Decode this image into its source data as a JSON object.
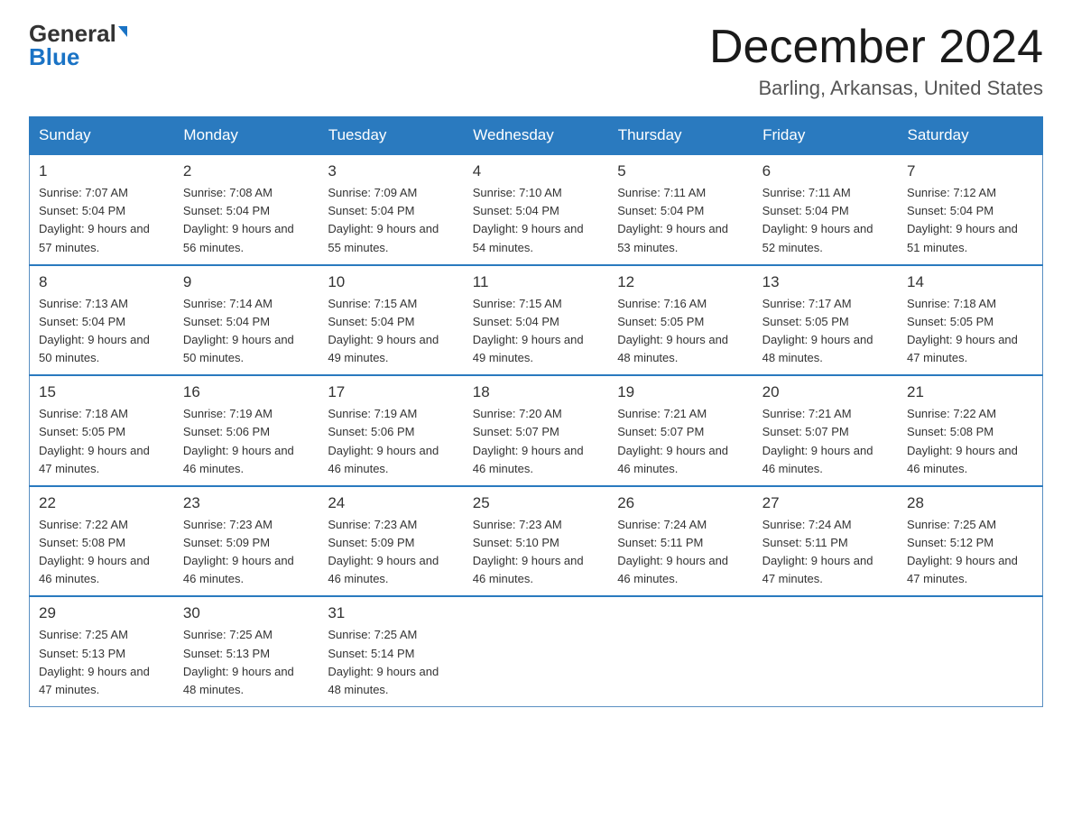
{
  "header": {
    "logo_general": "General",
    "logo_blue": "Blue",
    "month_title": "December 2024",
    "location": "Barling, Arkansas, United States"
  },
  "weekdays": [
    "Sunday",
    "Monday",
    "Tuesday",
    "Wednesday",
    "Thursday",
    "Friday",
    "Saturday"
  ],
  "weeks": [
    [
      {
        "day": "1",
        "sunrise": "Sunrise: 7:07 AM",
        "sunset": "Sunset: 5:04 PM",
        "daylight": "Daylight: 9 hours and 57 minutes."
      },
      {
        "day": "2",
        "sunrise": "Sunrise: 7:08 AM",
        "sunset": "Sunset: 5:04 PM",
        "daylight": "Daylight: 9 hours and 56 minutes."
      },
      {
        "day": "3",
        "sunrise": "Sunrise: 7:09 AM",
        "sunset": "Sunset: 5:04 PM",
        "daylight": "Daylight: 9 hours and 55 minutes."
      },
      {
        "day": "4",
        "sunrise": "Sunrise: 7:10 AM",
        "sunset": "Sunset: 5:04 PM",
        "daylight": "Daylight: 9 hours and 54 minutes."
      },
      {
        "day": "5",
        "sunrise": "Sunrise: 7:11 AM",
        "sunset": "Sunset: 5:04 PM",
        "daylight": "Daylight: 9 hours and 53 minutes."
      },
      {
        "day": "6",
        "sunrise": "Sunrise: 7:11 AM",
        "sunset": "Sunset: 5:04 PM",
        "daylight": "Daylight: 9 hours and 52 minutes."
      },
      {
        "day": "7",
        "sunrise": "Sunrise: 7:12 AM",
        "sunset": "Sunset: 5:04 PM",
        "daylight": "Daylight: 9 hours and 51 minutes."
      }
    ],
    [
      {
        "day": "8",
        "sunrise": "Sunrise: 7:13 AM",
        "sunset": "Sunset: 5:04 PM",
        "daylight": "Daylight: 9 hours and 50 minutes."
      },
      {
        "day": "9",
        "sunrise": "Sunrise: 7:14 AM",
        "sunset": "Sunset: 5:04 PM",
        "daylight": "Daylight: 9 hours and 50 minutes."
      },
      {
        "day": "10",
        "sunrise": "Sunrise: 7:15 AM",
        "sunset": "Sunset: 5:04 PM",
        "daylight": "Daylight: 9 hours and 49 minutes."
      },
      {
        "day": "11",
        "sunrise": "Sunrise: 7:15 AM",
        "sunset": "Sunset: 5:04 PM",
        "daylight": "Daylight: 9 hours and 49 minutes."
      },
      {
        "day": "12",
        "sunrise": "Sunrise: 7:16 AM",
        "sunset": "Sunset: 5:05 PM",
        "daylight": "Daylight: 9 hours and 48 minutes."
      },
      {
        "day": "13",
        "sunrise": "Sunrise: 7:17 AM",
        "sunset": "Sunset: 5:05 PM",
        "daylight": "Daylight: 9 hours and 48 minutes."
      },
      {
        "day": "14",
        "sunrise": "Sunrise: 7:18 AM",
        "sunset": "Sunset: 5:05 PM",
        "daylight": "Daylight: 9 hours and 47 minutes."
      }
    ],
    [
      {
        "day": "15",
        "sunrise": "Sunrise: 7:18 AM",
        "sunset": "Sunset: 5:05 PM",
        "daylight": "Daylight: 9 hours and 47 minutes."
      },
      {
        "day": "16",
        "sunrise": "Sunrise: 7:19 AM",
        "sunset": "Sunset: 5:06 PM",
        "daylight": "Daylight: 9 hours and 46 minutes."
      },
      {
        "day": "17",
        "sunrise": "Sunrise: 7:19 AM",
        "sunset": "Sunset: 5:06 PM",
        "daylight": "Daylight: 9 hours and 46 minutes."
      },
      {
        "day": "18",
        "sunrise": "Sunrise: 7:20 AM",
        "sunset": "Sunset: 5:07 PM",
        "daylight": "Daylight: 9 hours and 46 minutes."
      },
      {
        "day": "19",
        "sunrise": "Sunrise: 7:21 AM",
        "sunset": "Sunset: 5:07 PM",
        "daylight": "Daylight: 9 hours and 46 minutes."
      },
      {
        "day": "20",
        "sunrise": "Sunrise: 7:21 AM",
        "sunset": "Sunset: 5:07 PM",
        "daylight": "Daylight: 9 hours and 46 minutes."
      },
      {
        "day": "21",
        "sunrise": "Sunrise: 7:22 AM",
        "sunset": "Sunset: 5:08 PM",
        "daylight": "Daylight: 9 hours and 46 minutes."
      }
    ],
    [
      {
        "day": "22",
        "sunrise": "Sunrise: 7:22 AM",
        "sunset": "Sunset: 5:08 PM",
        "daylight": "Daylight: 9 hours and 46 minutes."
      },
      {
        "day": "23",
        "sunrise": "Sunrise: 7:23 AM",
        "sunset": "Sunset: 5:09 PM",
        "daylight": "Daylight: 9 hours and 46 minutes."
      },
      {
        "day": "24",
        "sunrise": "Sunrise: 7:23 AM",
        "sunset": "Sunset: 5:09 PM",
        "daylight": "Daylight: 9 hours and 46 minutes."
      },
      {
        "day": "25",
        "sunrise": "Sunrise: 7:23 AM",
        "sunset": "Sunset: 5:10 PM",
        "daylight": "Daylight: 9 hours and 46 minutes."
      },
      {
        "day": "26",
        "sunrise": "Sunrise: 7:24 AM",
        "sunset": "Sunset: 5:11 PM",
        "daylight": "Daylight: 9 hours and 46 minutes."
      },
      {
        "day": "27",
        "sunrise": "Sunrise: 7:24 AM",
        "sunset": "Sunset: 5:11 PM",
        "daylight": "Daylight: 9 hours and 47 minutes."
      },
      {
        "day": "28",
        "sunrise": "Sunrise: 7:25 AM",
        "sunset": "Sunset: 5:12 PM",
        "daylight": "Daylight: 9 hours and 47 minutes."
      }
    ],
    [
      {
        "day": "29",
        "sunrise": "Sunrise: 7:25 AM",
        "sunset": "Sunset: 5:13 PM",
        "daylight": "Daylight: 9 hours and 47 minutes."
      },
      {
        "day": "30",
        "sunrise": "Sunrise: 7:25 AM",
        "sunset": "Sunset: 5:13 PM",
        "daylight": "Daylight: 9 hours and 48 minutes."
      },
      {
        "day": "31",
        "sunrise": "Sunrise: 7:25 AM",
        "sunset": "Sunset: 5:14 PM",
        "daylight": "Daylight: 9 hours and 48 minutes."
      },
      null,
      null,
      null,
      null
    ]
  ]
}
